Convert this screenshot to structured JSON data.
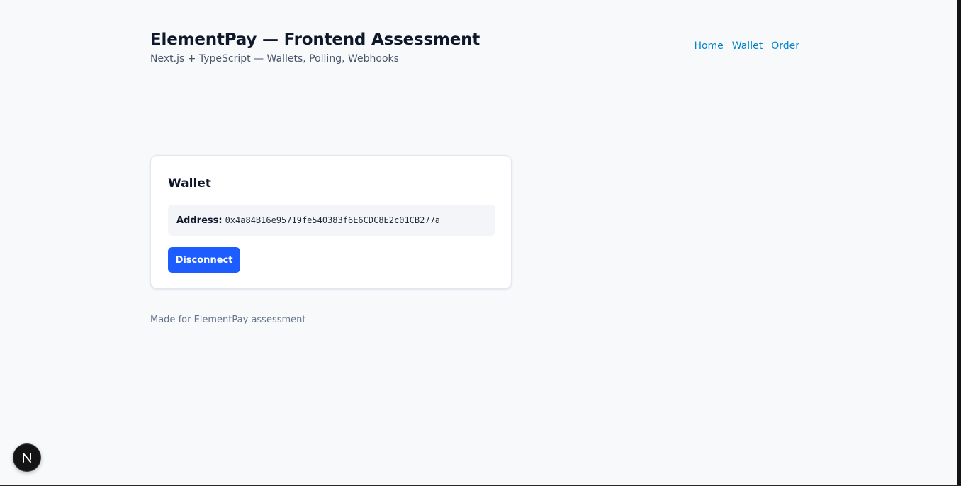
{
  "header": {
    "title": "ElementPay — Frontend Assessment",
    "subtitle": "Next.js + TypeScript — Wallets, Polling, Webhooks"
  },
  "nav": {
    "items": [
      {
        "label": "Home"
      },
      {
        "label": "Wallet"
      },
      {
        "label": "Order"
      }
    ],
    "link_color": "#0284c7"
  },
  "wallet_card": {
    "title": "Wallet",
    "address_label": "Address:",
    "address_value": "0x4a84B16e95719fe540383f6E6CDC8E2c01CB277a",
    "disconnect_label": "Disconnect",
    "button_color": "#1d5dff"
  },
  "footer": {
    "text": "Made for ElementPay assessment"
  },
  "dev_badge": {
    "icon": "nextjs-logo-icon"
  }
}
